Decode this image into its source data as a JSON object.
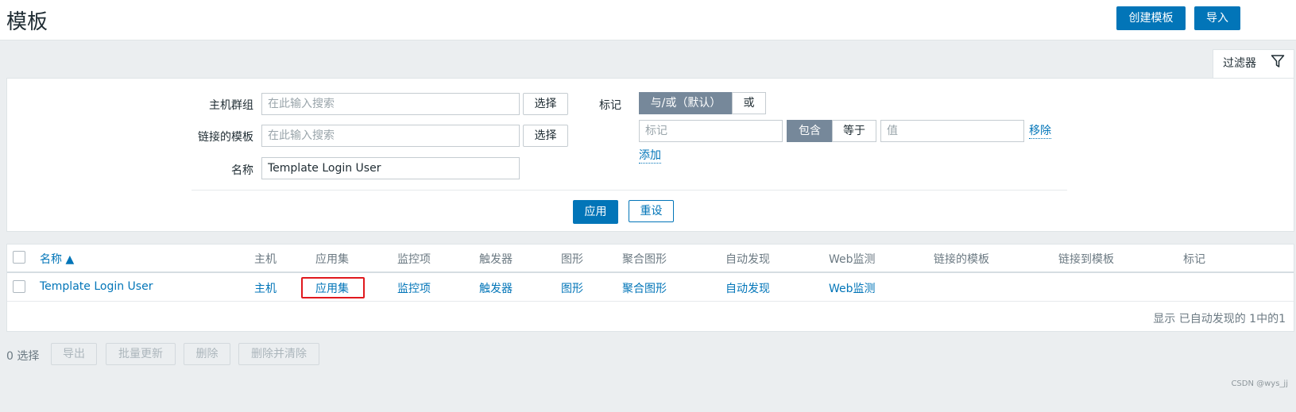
{
  "header": {
    "title": "模板",
    "create_template_label": "创建模板",
    "import_label": "导入"
  },
  "filter": {
    "tab_label": "过滤器",
    "host_group_label": "主机群组",
    "host_group_placeholder": "在此输入搜索",
    "linked_templates_label": "链接的模板",
    "linked_templates_placeholder": "在此输入搜索",
    "name_label": "名称",
    "name_value": "Template Login User",
    "select_label": "选择",
    "tags_label": "标记",
    "tags_operator": [
      "与/或（默认）",
      "或"
    ],
    "tag_placeholder": "标记",
    "tag_match": [
      "包含",
      "等于"
    ],
    "value_placeholder": "值",
    "remove_label": "移除",
    "add_label": "添加",
    "apply_label": "应用",
    "reset_label": "重设"
  },
  "table": {
    "columns": [
      "名称 ▲",
      "主机",
      "应用集",
      "监控项",
      "触发器",
      "图形",
      "聚合图形",
      "自动发现",
      "Web监测",
      "链接的模板",
      "链接到模板",
      "标记"
    ],
    "rows": [
      {
        "name": "Template Login User",
        "hosts": "主机",
        "applications": "应用集",
        "items": "监控项",
        "triggers": "触发器",
        "graphs": "图形",
        "screens": "聚合图形",
        "discovery": "自动发现",
        "web": "Web监测"
      }
    ],
    "footer": "显示 已自动发现的 1中的1"
  },
  "bulk": {
    "selected": "0 选择",
    "export_label": "导出",
    "mass_update_label": "批量更新",
    "delete_label": "删除",
    "delete_clear_label": "删除并清除"
  },
  "watermark": "CSDN @wys_jj",
  "colors": {
    "accent": "#0275b8",
    "segment_active": "#76889a",
    "highlight_box": "#e0191e",
    "background": "#ebeef0"
  }
}
